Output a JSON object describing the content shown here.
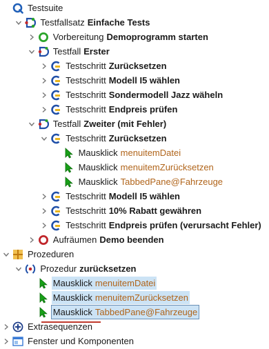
{
  "tree": {
    "rows": [
      {
        "type": "Testsuite",
        "name": "",
        "target": "",
        "icon": "testsuite-icon",
        "chevron": "none",
        "indent": 0,
        "hl": ""
      },
      {
        "type": "Testfallsatz",
        "name": "Einfache Tests",
        "target": "",
        "icon": "testcase-set-icon",
        "chevron": "expanded",
        "indent": 1,
        "hl": ""
      },
      {
        "type": "Vorbereitung",
        "name": "Demoprogramm starten",
        "target": "",
        "icon": "setup-icon",
        "chevron": "collapsed",
        "indent": 2,
        "hl": ""
      },
      {
        "type": "Testfall",
        "name": "Erster",
        "target": "",
        "icon": "testcase-icon",
        "chevron": "expanded",
        "indent": 2,
        "hl": ""
      },
      {
        "type": "Testschritt",
        "name": "Zurücksetzen",
        "target": "",
        "icon": "teststep-icon",
        "chevron": "collapsed",
        "indent": 3,
        "hl": ""
      },
      {
        "type": "Testschritt",
        "name": "Modell I5 wählen",
        "target": "",
        "icon": "teststep-icon",
        "chevron": "collapsed",
        "indent": 3,
        "hl": ""
      },
      {
        "type": "Testschritt",
        "name": "Sondermodell Jazz wäheln",
        "target": "",
        "icon": "teststep-icon",
        "chevron": "collapsed",
        "indent": 3,
        "hl": ""
      },
      {
        "type": "Testschritt",
        "name": "Endpreis prüfen",
        "target": "",
        "icon": "teststep-icon",
        "chevron": "collapsed",
        "indent": 3,
        "hl": ""
      },
      {
        "type": "Testfall",
        "name": "Zweiter (mit Fehler)",
        "target": "",
        "icon": "testcase-icon",
        "chevron": "expanded",
        "indent": 2,
        "hl": ""
      },
      {
        "type": "Testschritt",
        "name": "Zurücksetzen",
        "target": "",
        "icon": "teststep-icon",
        "chevron": "expanded",
        "indent": 3,
        "hl": ""
      },
      {
        "type": "Mausklick",
        "name": "",
        "target": "menuitemDatei",
        "icon": "mouse-click-icon",
        "chevron": "none",
        "indent": 4,
        "hl": ""
      },
      {
        "type": "Mausklick",
        "name": "",
        "target": "menuitemZurücksetzen",
        "icon": "mouse-click-icon",
        "chevron": "none",
        "indent": 4,
        "hl": ""
      },
      {
        "type": "Mausklick",
        "name": "",
        "target": "TabbedPane@Fahrzeuge",
        "icon": "mouse-click-icon",
        "chevron": "none",
        "indent": 4,
        "hl": ""
      },
      {
        "type": "Testschritt",
        "name": "Modell I5 wählen",
        "target": "",
        "icon": "teststep-icon",
        "chevron": "collapsed",
        "indent": 3,
        "hl": ""
      },
      {
        "type": "Testschritt",
        "name": "10% Rabatt gewähren",
        "target": "",
        "icon": "teststep-icon",
        "chevron": "collapsed",
        "indent": 3,
        "hl": ""
      },
      {
        "type": "Testschritt",
        "name": "Endpreis prüfen (verursacht Fehler)",
        "target": "",
        "icon": "teststep-icon",
        "chevron": "collapsed",
        "indent": 3,
        "hl": ""
      },
      {
        "type": "Aufräumen",
        "name": "Demo beenden",
        "target": "",
        "icon": "cleanup-icon",
        "chevron": "collapsed",
        "indent": 2,
        "hl": ""
      },
      {
        "type": "Prozeduren",
        "name": "",
        "target": "",
        "icon": "procedures-icon",
        "chevron": "expanded",
        "indent": 0,
        "hl": ""
      },
      {
        "type": "Prozedur",
        "name": "zurücksetzen",
        "target": "",
        "icon": "procedure-icon",
        "chevron": "expanded",
        "indent": 1,
        "hl": ""
      },
      {
        "type": "Mausklick",
        "name": "",
        "target": "menuitemDatei",
        "icon": "mouse-click-icon",
        "chevron": "none",
        "indent": 2,
        "hl": "hl"
      },
      {
        "type": "Mausklick",
        "name": "",
        "target": "menuitemZurücksetzen",
        "icon": "mouse-click-icon",
        "chevron": "none",
        "indent": 2,
        "hl": "hl"
      },
      {
        "type": "Mausklick",
        "name": "",
        "target": "TabbedPane@Fahrzeuge",
        "icon": "mouse-click-icon",
        "chevron": "none",
        "indent": 2,
        "hl": "sel"
      },
      {
        "type": "Extrasequenzen",
        "name": "",
        "target": "",
        "icon": "extras-icon",
        "chevron": "collapsed",
        "indent": 0,
        "hl": ""
      },
      {
        "type": "Fenster und Komponenten",
        "name": "",
        "target": "",
        "icon": "windows-icon",
        "chevron": "collapsed",
        "indent": 0,
        "hl": ""
      }
    ]
  },
  "colors": {
    "suite_blue": "#1f5fb8",
    "step_blue": "#1f4fa8",
    "step_yellow": "#e8b41c",
    "setup_green": "#2aa52a",
    "cleanup_red": "#c0262b",
    "cursor_green": "#18a018",
    "target_text": "#b0641a",
    "highlight": "#cce3f5",
    "procedure_orange": "#e0a020"
  }
}
